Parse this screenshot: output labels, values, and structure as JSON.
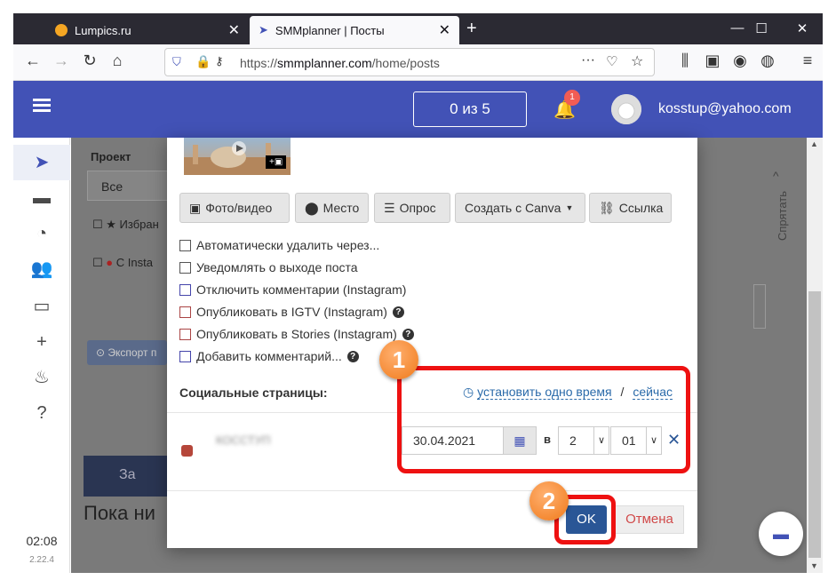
{
  "browser": {
    "tabs": [
      {
        "title": "Lumpics.ru",
        "close": "✕"
      },
      {
        "title": "SMMplanner | Посты",
        "close": "✕"
      }
    ],
    "new_tab": "+",
    "url_prefix": "https://",
    "url_host": "smmplanner.com",
    "url_path": "/home/posts"
  },
  "header": {
    "counter": "0 из 5",
    "notifications": "1",
    "email": "kosstup@yahoo.com"
  },
  "sidebar": {
    "time": "02:08",
    "version": "2.22.4"
  },
  "background": {
    "project_label": "Проект",
    "project_value": "Все",
    "filter1": "Избран",
    "filter2": "С Insta",
    "export": "Экспорт п",
    "big_btn": "За",
    "empty": "Пока ни",
    "hide": "Спрятать"
  },
  "modal": {
    "buttons": [
      "Фото/видео",
      "Место",
      "Опрос",
      "Создать с Canva",
      "Ссылка"
    ],
    "options": [
      "Автоматически удалить через...",
      "Уведомлять о выходе поста",
      "Отключить комментарии (Instagram)",
      "Опубликовать в IGTV (Instagram)",
      "Опубликовать в Stories (Instagram)",
      "Добавить комментарий..."
    ],
    "social_label": "Социальные страницы:",
    "one_time": "установить одно время",
    "sep": "/",
    "now": "сейчас",
    "account_blurred": "КОССТУП",
    "date": "30.04.2021",
    "at": "в",
    "hour": "2",
    "minute": "01",
    "ok": "OK",
    "cancel": "Отмена"
  },
  "annotations": {
    "step1": "1",
    "step2": "2"
  },
  "colors": {
    "header": "#4252b6",
    "ok": "#2a5696",
    "highlight": "#ee1111",
    "marker": "#f07a1a"
  }
}
